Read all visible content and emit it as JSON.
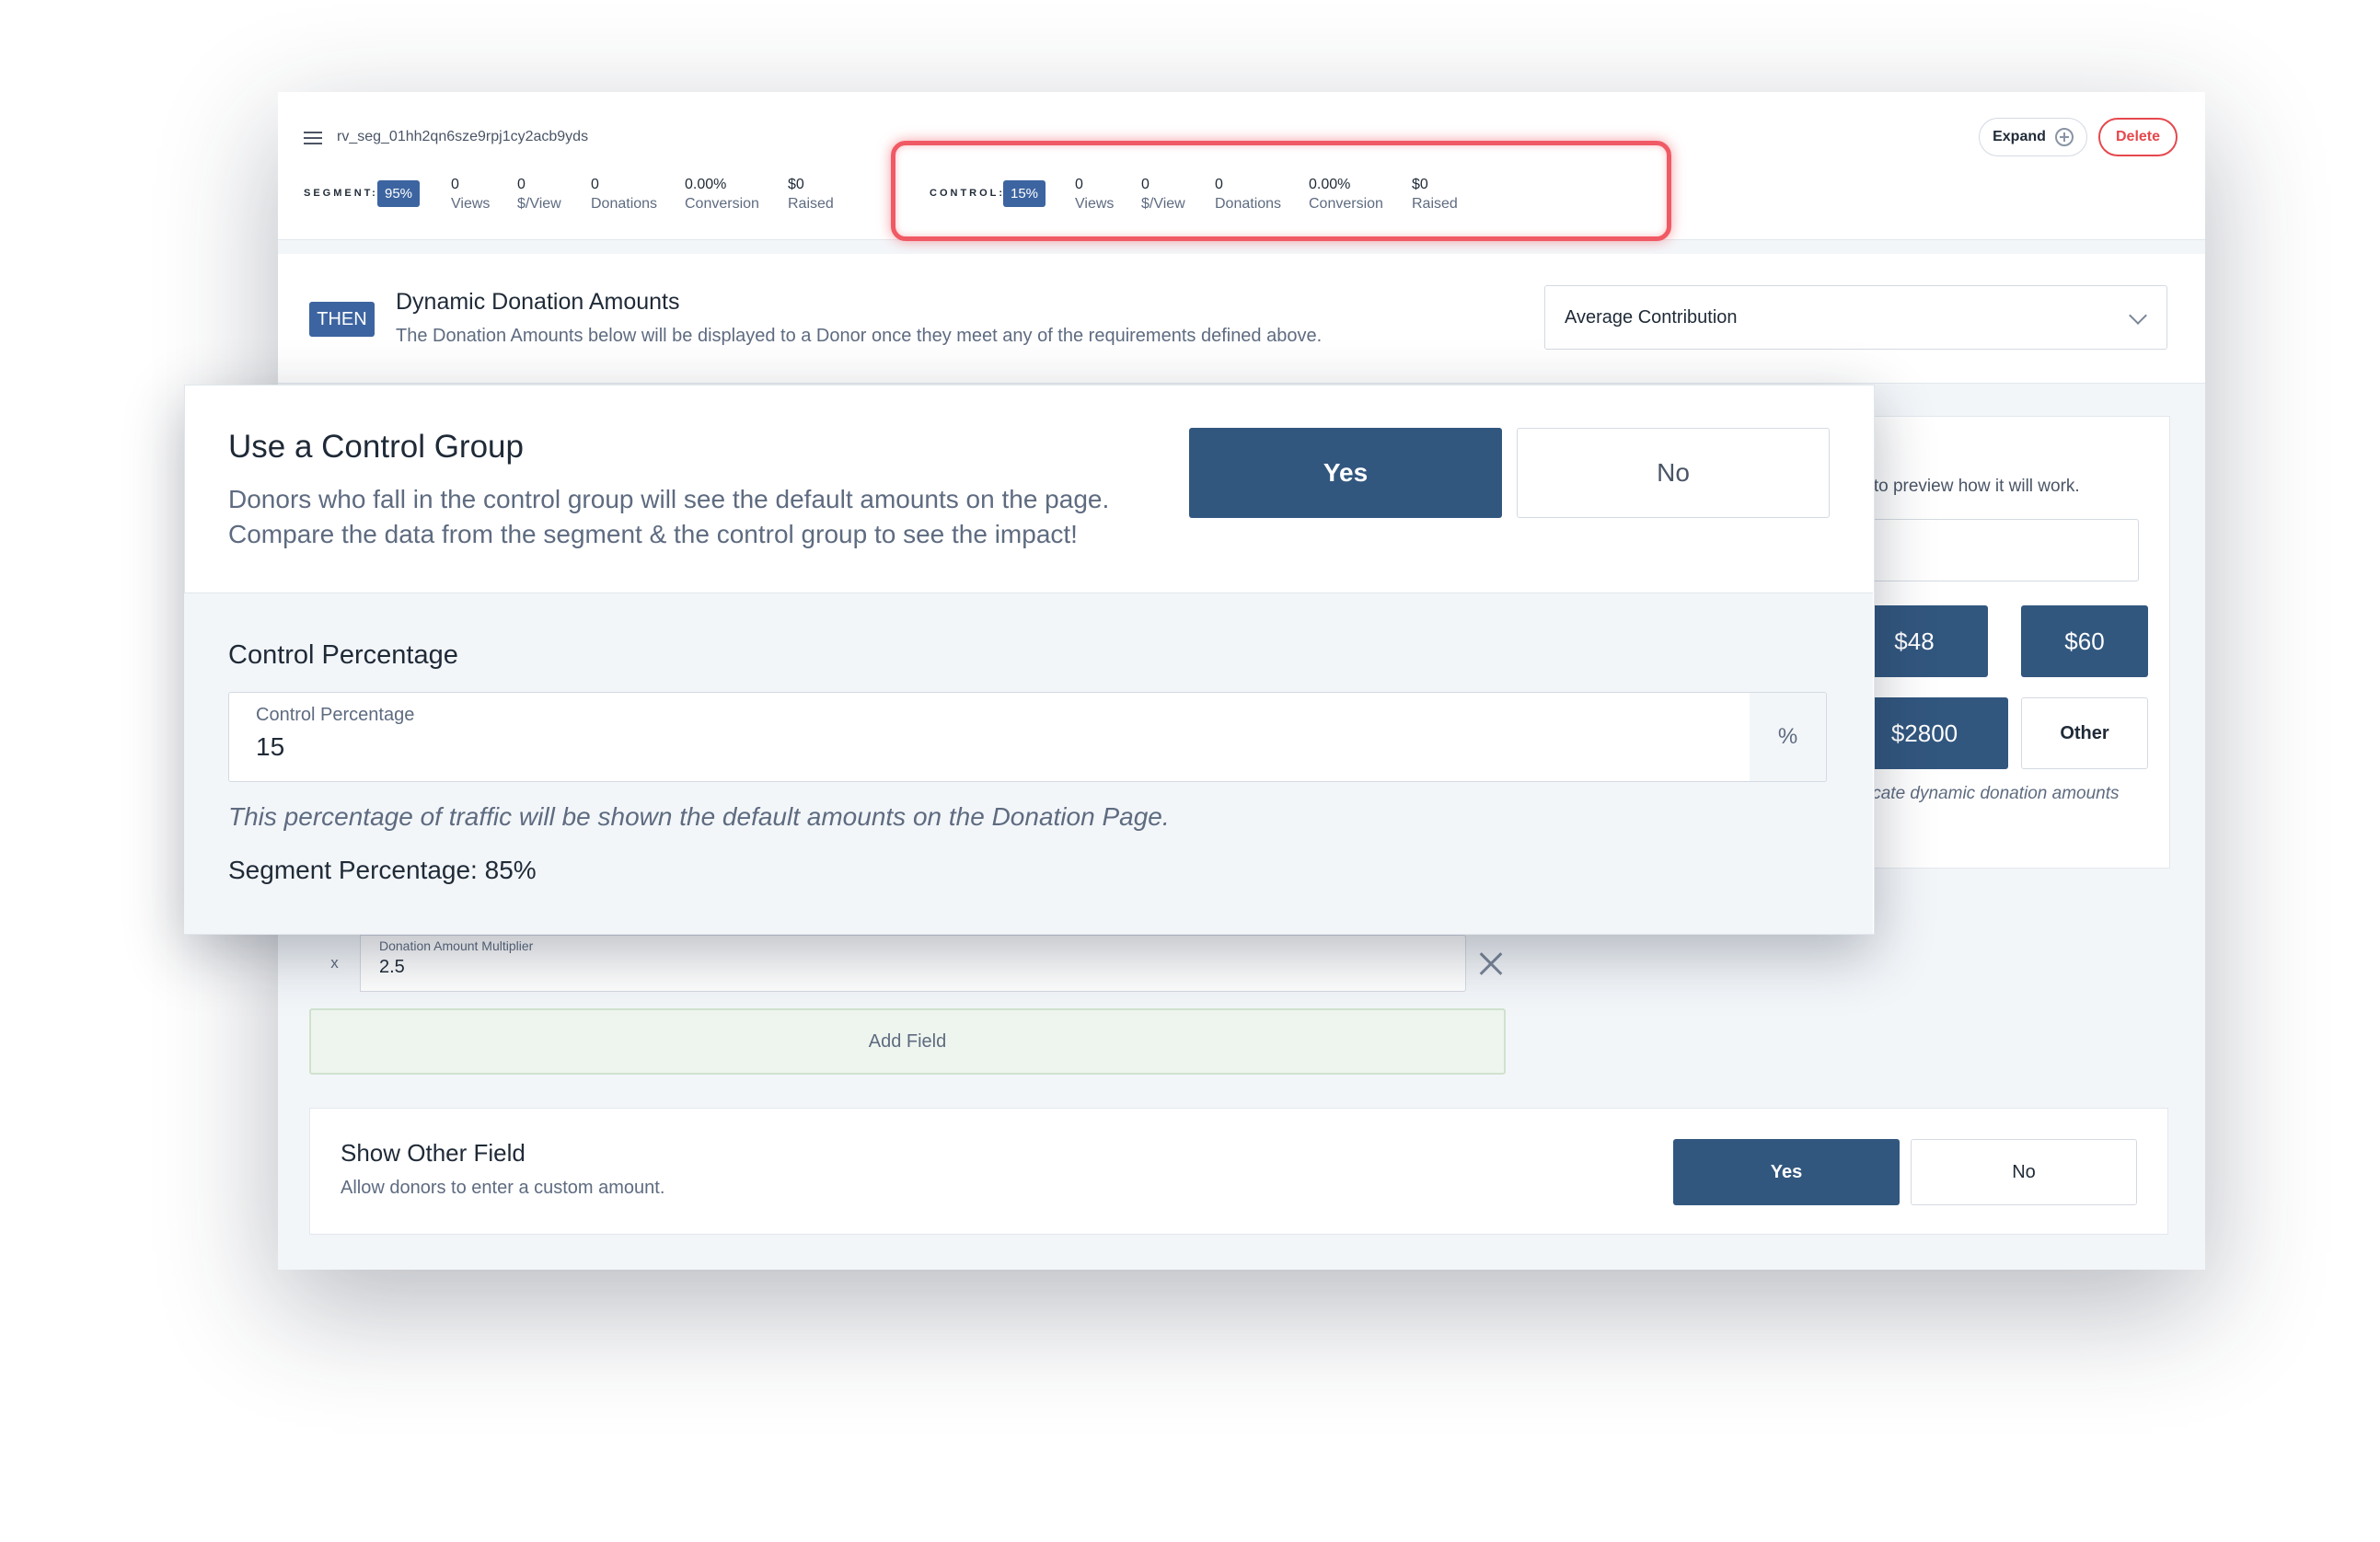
{
  "header": {
    "segment_id": "rv_seg_01hh2qn6sze9rpj1cy2acb9yds",
    "segment": {
      "label": "SEGMENT:",
      "percent": "95%",
      "stats": [
        {
          "value": "0",
          "label": "Views"
        },
        {
          "value": "0",
          "label": "$/View"
        },
        {
          "value": "0",
          "label": "Donations"
        },
        {
          "value": "0.00%",
          "label": "Conversion"
        },
        {
          "value": "$0",
          "label": "Raised"
        }
      ]
    },
    "control": {
      "label": "CONTROL:",
      "percent": "15%",
      "stats": [
        {
          "value": "0",
          "label": "Views"
        },
        {
          "value": "0",
          "label": "$/View"
        },
        {
          "value": "0",
          "label": "Donations"
        },
        {
          "value": "0.00%",
          "label": "Conversion"
        },
        {
          "value": "$0",
          "label": "Raised"
        }
      ]
    },
    "expand_label": "Expand",
    "delete_label": "Delete"
  },
  "then": {
    "badge": "THEN",
    "title": "Dynamic Donation Amounts",
    "subtitle": "The Donation Amounts below will be displayed to a Donor once they meet any of the requirements defined above.",
    "select_value": "Average Contribution"
  },
  "preview": {
    "text": "n to preview how it will work.",
    "amounts": [
      "$48",
      "$60",
      "$2800"
    ],
    "other_label": "Other",
    "note": "icate dynamic donation amounts"
  },
  "multiplier": {
    "prefix": "x",
    "label": "Donation Amount Multiplier",
    "value": "2.5"
  },
  "add_field_label": "Add Field",
  "show_other": {
    "title": "Show Other Field",
    "subtitle": "Allow donors to enter a custom amount.",
    "yes_label": "Yes",
    "no_label": "No"
  },
  "modal": {
    "title": "Use a Control Group",
    "description_line1": "Donors who fall in the control group will see the default amounts on the page.",
    "description_line2": "Compare the data from the segment & the control group to see the impact!",
    "yes_label": "Yes",
    "no_label": "No",
    "section_heading": "Control Percentage",
    "input_label": "Control Percentage",
    "input_value": "15",
    "input_suffix": "%",
    "note": "This percentage of traffic will be shown the default amounts on the Donation Page.",
    "segment_percentage": "Segment Percentage: 85%"
  },
  "colors": {
    "primary": "#32577f",
    "badge": "#3c64a0",
    "danger": "#e5484d",
    "highlight": "#f05a64"
  }
}
